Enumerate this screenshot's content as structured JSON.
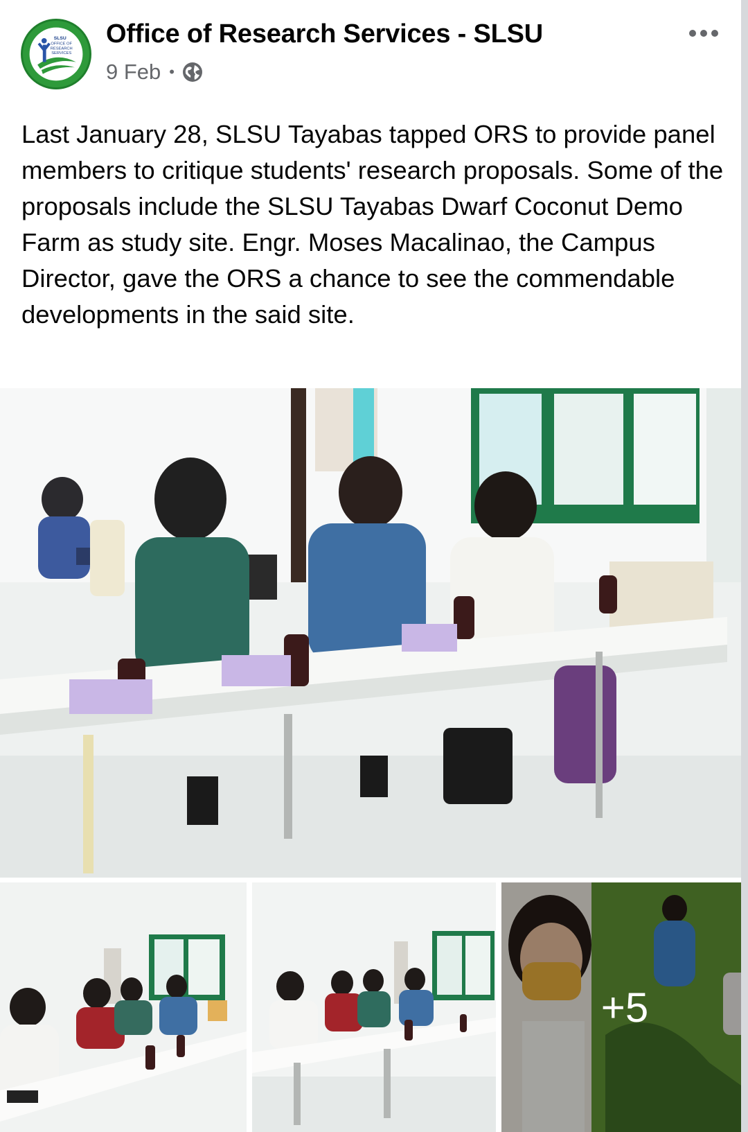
{
  "post": {
    "author": "Office of Research Services - SLSU",
    "date": "9 Feb",
    "separator": "•",
    "visibility_icon": "globe-icon",
    "more_icon": "more-options-icon",
    "caption": "Last January 28, SLSU Tayabas tapped ORS to provide panel members to critique students' research proposals. Some of the proposals include the SLSU Tayabas Dwarf Coconut Demo Farm as study site. Engr. Moses Macalinao, the Campus Director, gave the ORS a chance to see the commendable developments in the said site.",
    "avatar_logo_text": [
      "SLSU",
      "OFFICE OF",
      "RESEARCH",
      "SERVICES"
    ]
  },
  "photos": {
    "remaining_count_label": "+5"
  },
  "colors": {
    "name_text": "#050505",
    "meta_text": "#65676b",
    "logo_green": "#2e9a3a",
    "overlay": "rgba(0,0,0,0.32)"
  }
}
